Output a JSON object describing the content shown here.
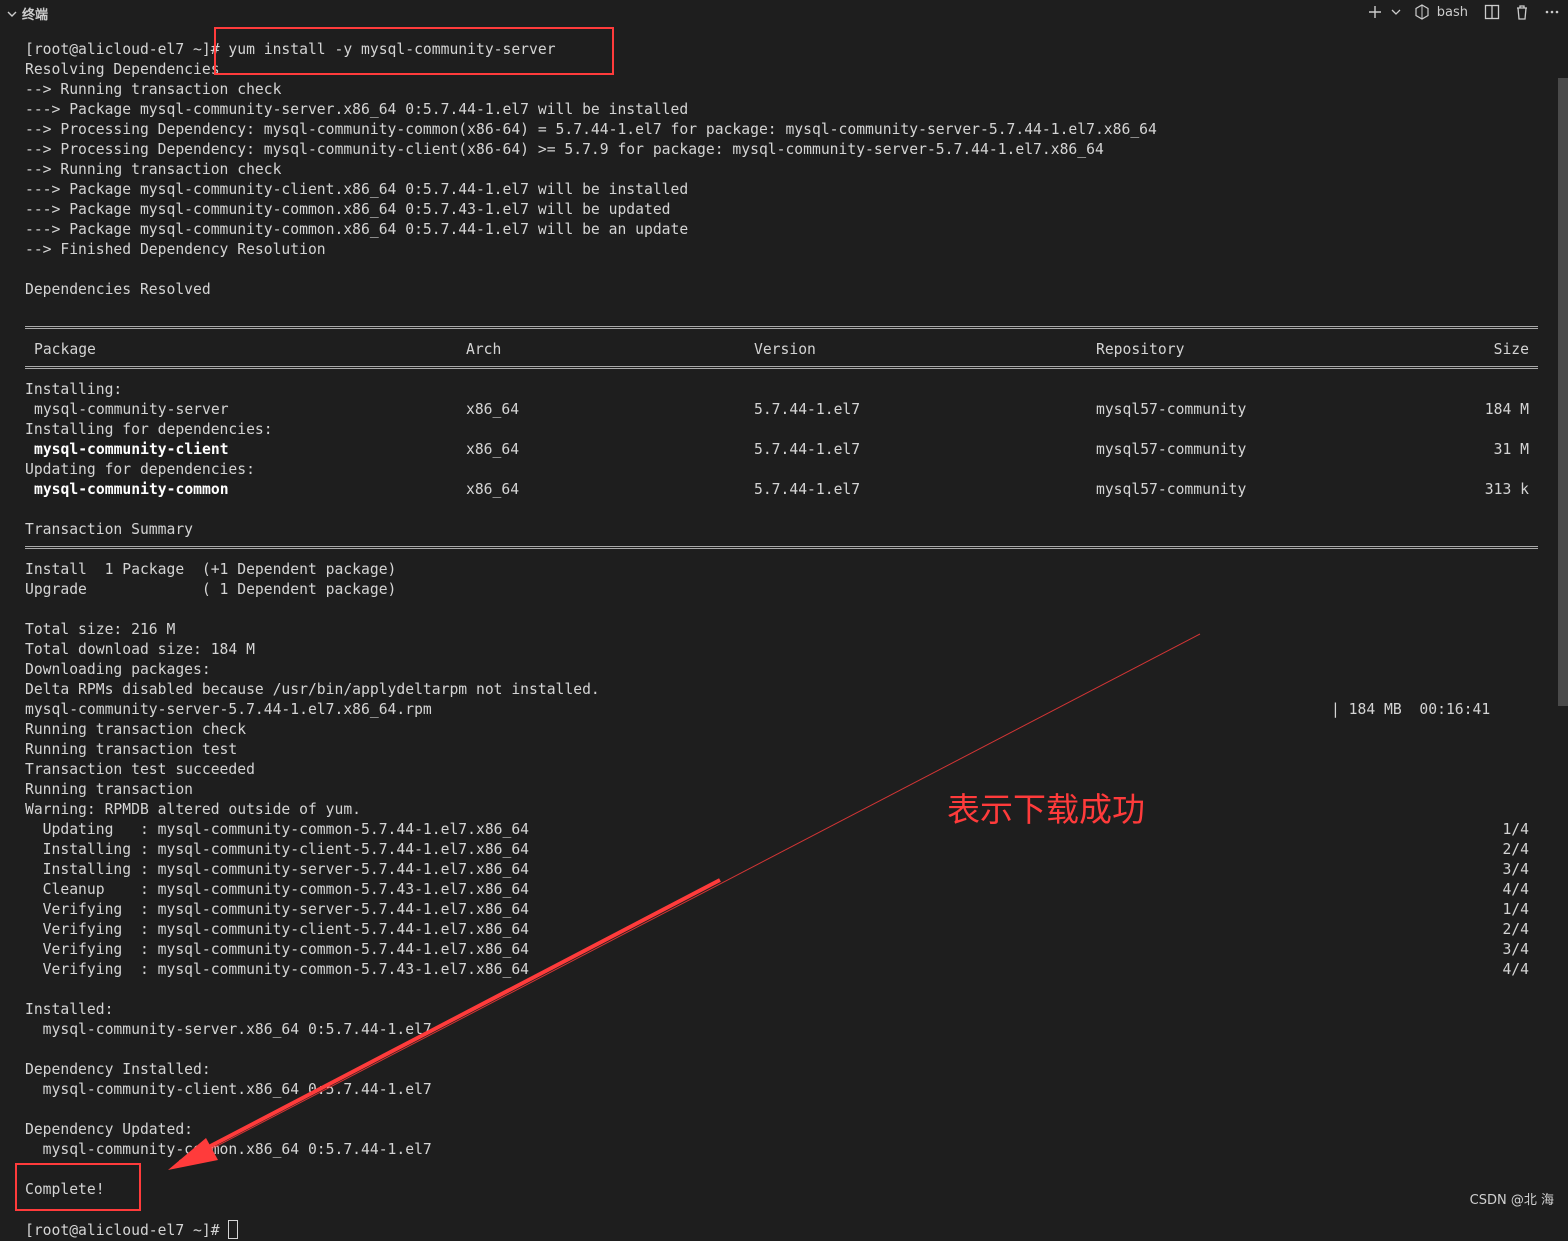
{
  "panel": {
    "title": "终端",
    "shell_name": "bash",
    "icons": [
      "chevron-down-icon",
      "plus-icon",
      "dropdown-icon",
      "shell-icon",
      "split-icon",
      "trash-icon",
      "more-icon"
    ]
  },
  "terminal": {
    "lines_top": [
      "[root@alicloud-el7 ~]# yum install -y mysql-community-server",
      "Resolving Dependencies",
      "--> Running transaction check",
      "---> Package mysql-community-server.x86_64 0:5.7.44-1.el7 will be installed",
      "--> Processing Dependency: mysql-community-common(x86-64) = 5.7.44-1.el7 for package: mysql-community-server-5.7.44-1.el7.x86_64",
      "--> Processing Dependency: mysql-community-client(x86-64) >= 5.7.9 for package: mysql-community-server-5.7.44-1.el7.x86_64",
      "--> Running transaction check",
      "---> Package mysql-community-client.x86_64 0:5.7.44-1.el7 will be installed",
      "---> Package mysql-community-common.x86_64 0:5.7.43-1.el7 will be updated",
      "---> Package mysql-community-common.x86_64 0:5.7.44-1.el7 will be an update",
      "--> Finished Dependency Resolution",
      "",
      "Dependencies Resolved"
    ],
    "table": {
      "headers": {
        "package": "Package",
        "arch": "Arch",
        "version": "Version",
        "repository": "Repository",
        "size": "Size"
      },
      "sections": [
        {
          "label": "Installing:",
          "row": {
            "package": "mysql-community-server",
            "arch": "x86_64",
            "version": "5.7.44-1.el7",
            "repository": "mysql57-community",
            "size": "184 M",
            "bold": false
          }
        },
        {
          "label": "Installing for dependencies:",
          "row": {
            "package": "mysql-community-client",
            "arch": "x86_64",
            "version": "5.7.44-1.el7",
            "repository": "mysql57-community",
            "size": "31 M",
            "bold": true
          }
        },
        {
          "label": "Updating for dependencies:",
          "row": {
            "package": "mysql-community-common",
            "arch": "x86_64",
            "version": "5.7.44-1.el7",
            "repository": "mysql57-community",
            "size": "313 k",
            "bold": true
          }
        }
      ]
    },
    "summary_title": "Transaction Summary",
    "summary_lines": [
      "Install  1 Package  (+1 Dependent package)",
      "Upgrade             ( 1 Dependent package)"
    ],
    "download_lines": [
      "Total size: 216 M",
      "Total download size: 184 M",
      "Downloading packages:",
      "Delta RPMs disabled because /usr/bin/applydeltarpm not installed."
    ],
    "rpm_file": "mysql-community-server-5.7.44-1.el7.x86_64.rpm",
    "rpm_progress": "| 184 MB  00:16:41",
    "transaction_lines": [
      "Running transaction check",
      "Running transaction test",
      "Transaction test succeeded",
      "Running transaction",
      "Warning: RPMDB altered outside of yum."
    ],
    "steps": [
      {
        "text": "  Updating   : mysql-community-common-5.7.44-1.el7.x86_64",
        "count": "1/4"
      },
      {
        "text": "  Installing : mysql-community-client-5.7.44-1.el7.x86_64",
        "count": "2/4"
      },
      {
        "text": "  Installing : mysql-community-server-5.7.44-1.el7.x86_64",
        "count": "3/4"
      },
      {
        "text": "  Cleanup    : mysql-community-common-5.7.43-1.el7.x86_64",
        "count": "4/4"
      },
      {
        "text": "  Verifying  : mysql-community-server-5.7.44-1.el7.x86_64",
        "count": "1/4"
      },
      {
        "text": "  Verifying  : mysql-community-client-5.7.44-1.el7.x86_64",
        "count": "2/4"
      },
      {
        "text": "  Verifying  : mysql-community-common-5.7.44-1.el7.x86_64",
        "count": "3/4"
      },
      {
        "text": "  Verifying  : mysql-community-common-5.7.43-1.el7.x86_64",
        "count": "4/4"
      }
    ],
    "result_lines": [
      "",
      "Installed:",
      "  mysql-community-server.x86_64 0:5.7.44-1.el7",
      "",
      "Dependency Installed:",
      "  mysql-community-client.x86_64 0:5.7.44-1.el7",
      "",
      "Dependency Updated:",
      "  mysql-community-common.x86_64 0:5.7.44-1.el7",
      "",
      "Complete!"
    ],
    "prompt": "[root@alicloud-el7 ~]# "
  },
  "annotation": {
    "text": "表示下载成功",
    "color": "#ff3b3b"
  },
  "watermark": "CSDN @北   海"
}
